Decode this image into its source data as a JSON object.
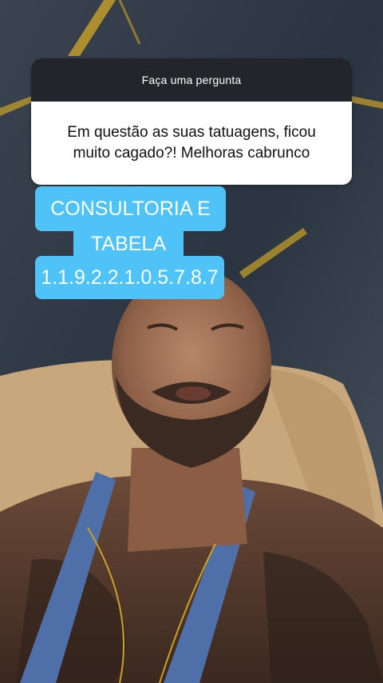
{
  "question_sticker": {
    "header": "Faça uma pergunta",
    "question_line1": "Em questão as suas tatuagens, ficou",
    "question_line2": "muito cagado?! Melhoras cabrunco"
  },
  "caption": {
    "line1": "CONSULTORIA E",
    "line2": "TABELA",
    "line3": "1.1.9.2.2.1.0.5.7.8.7"
  },
  "colors": {
    "caption_bg": "#4fc3f7",
    "card_header_bg": "#22252a"
  }
}
